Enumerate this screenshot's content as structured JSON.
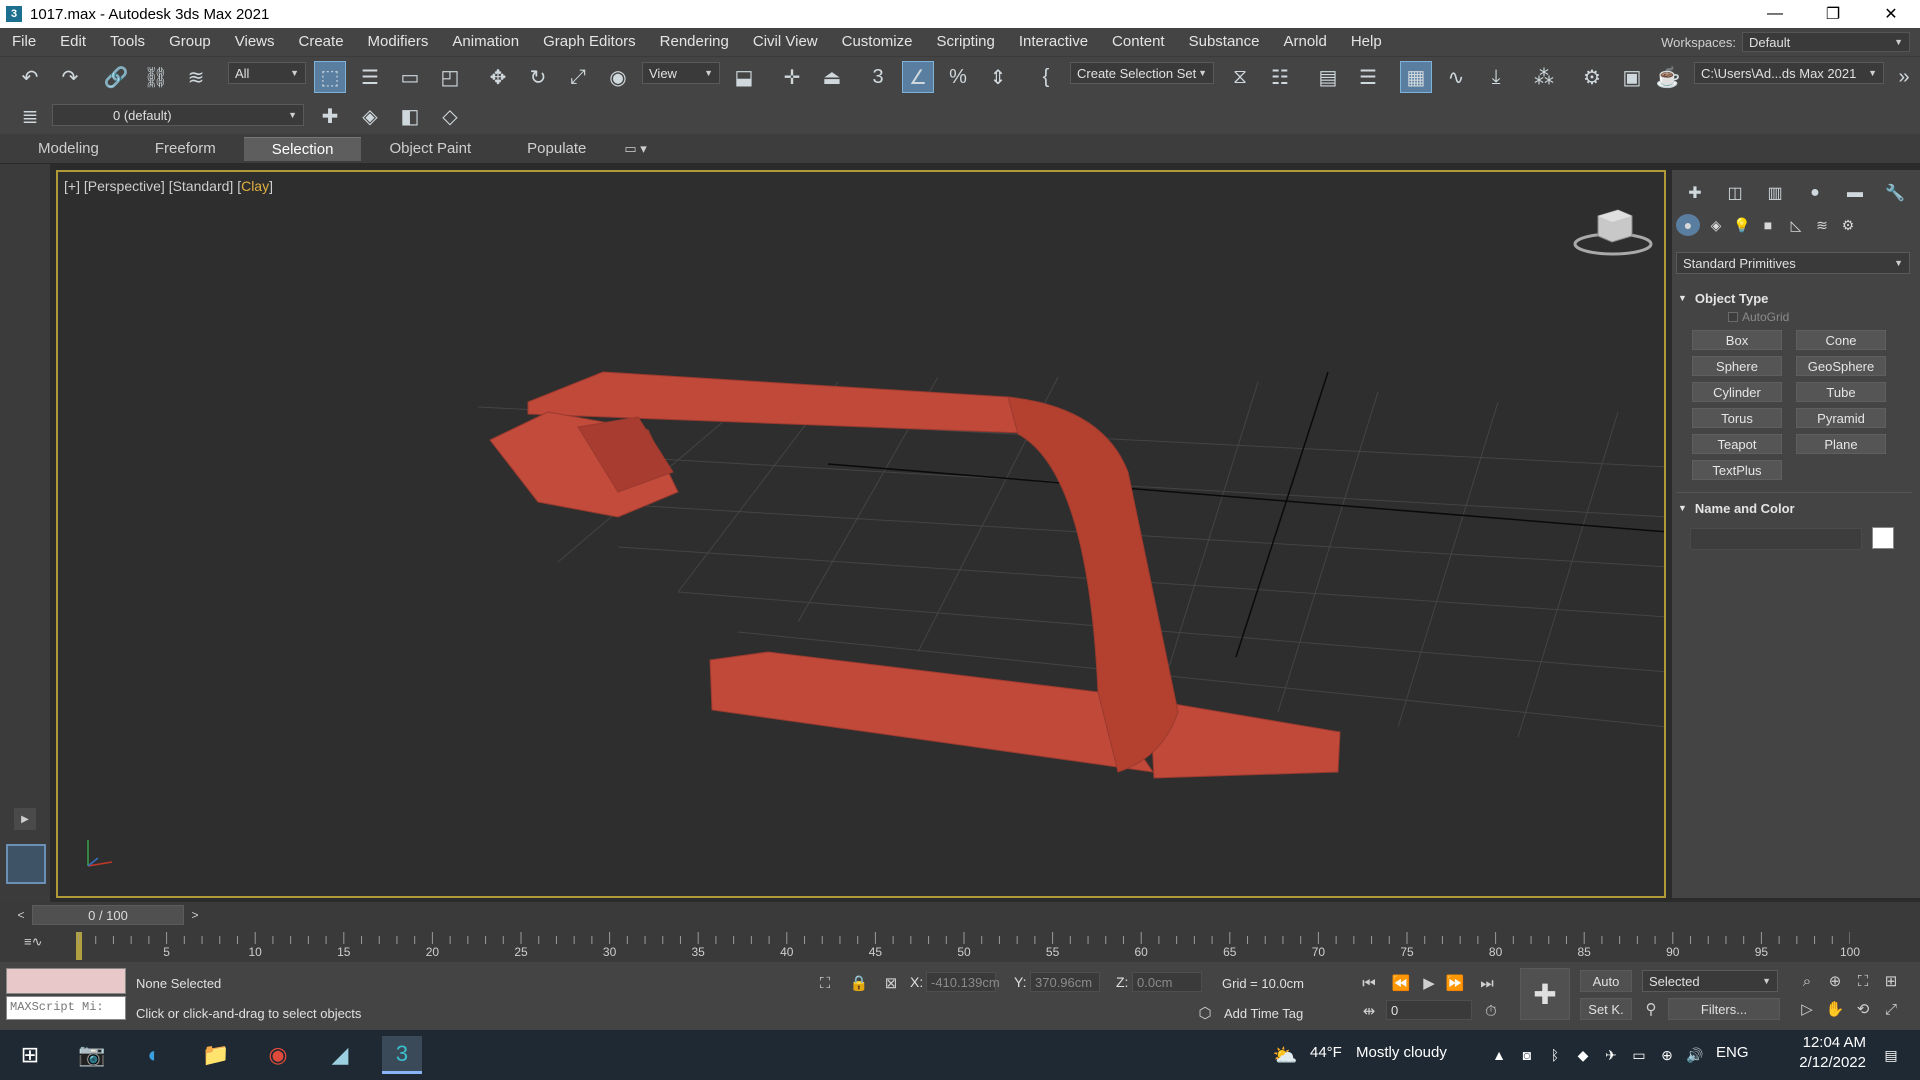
{
  "window": {
    "title": "1017.max - Autodesk 3ds Max 2021",
    "app_icon": "3ds-max-icon",
    "minimize": "—",
    "restore": "❐",
    "close": "✕"
  },
  "menu": {
    "items": [
      "File",
      "Edit",
      "Tools",
      "Group",
      "Views",
      "Create",
      "Modifiers",
      "Animation",
      "Graph Editors",
      "Rendering",
      "Civil View",
      "Customize",
      "Scripting",
      "Interactive",
      "Content",
      "Substance",
      "Arnold",
      "Help"
    ],
    "workspaces_label": "Workspaces:",
    "workspaces_value": "Default"
  },
  "toolbar": {
    "selection_filter": "All",
    "ref_coord": "View",
    "selection_set": "Create Selection Set",
    "project_path": "C:\\Users\\Ad...ds Max 2021",
    "layer": "0 (default)"
  },
  "ribbon": {
    "tabs": [
      "Modeling",
      "Freeform",
      "Selection",
      "Object Paint",
      "Populate"
    ],
    "active": "Selection"
  },
  "viewport": {
    "label_plus": "[+]",
    "label_view": "[Perspective]",
    "label_shading": "[Standard]",
    "label_style_open": "[",
    "label_style": "Clay",
    "label_style_close": "]",
    "object_color": "#c0493a",
    "border_color": "#b09a37"
  },
  "command_panel": {
    "category": "Standard Primitives",
    "object_type_title": "Object Type",
    "autogrid": "AutoGrid",
    "primitives": [
      "Box",
      "Cone",
      "Sphere",
      "GeoSphere",
      "Cylinder",
      "Tube",
      "Torus",
      "Pyramid",
      "Teapot",
      "Plane",
      "TextPlus"
    ],
    "name_color_title": "Name and Color"
  },
  "timeline": {
    "frame_display": "0 / 100",
    "prev": "<",
    "next": ">",
    "ticks": [
      "5",
      "10",
      "15",
      "20",
      "25",
      "30",
      "35",
      "40",
      "45",
      "50",
      "55",
      "60",
      "65",
      "70",
      "75",
      "80",
      "85",
      "90",
      "95",
      "100"
    ]
  },
  "status": {
    "maxscript_placeholder": "MAXScript Mi:",
    "selection": "None Selected",
    "prompt": "Click or click-and-drag to select objects",
    "x_label": "X:",
    "x_value": "-410.139cm",
    "y_label": "Y:",
    "y_value": "370.96cm",
    "z_label": "Z:",
    "z_value": "0.0cm",
    "grid": "Grid = 10.0cm",
    "add_time_tag": "Add Time Tag",
    "auto": "Auto",
    "selected": "Selected",
    "set_key": "Set K.",
    "filters": "Filters...",
    "frame_value": "0"
  },
  "taskbar": {
    "weather_temp": "44°F",
    "weather_desc": "Mostly cloudy",
    "language": "ENG",
    "time": "12:04 AM",
    "date": "2/12/2022"
  }
}
